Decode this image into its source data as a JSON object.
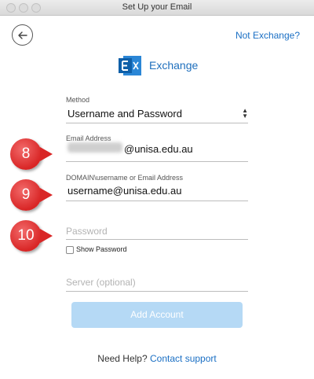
{
  "window": {
    "title": "Set Up your Email"
  },
  "header": {
    "not_exchange_link": "Not Exchange?",
    "brand_name": "Exchange"
  },
  "form": {
    "method": {
      "label": "Method",
      "value": "Username and Password"
    },
    "email": {
      "label": "Email Address",
      "value_visible": "@unisa.edu.au"
    },
    "domain_user": {
      "label": "DOMAIN\\username or Email Address",
      "value": "username@unisa.edu.au"
    },
    "password": {
      "placeholder": "Password"
    },
    "show_password": {
      "label": "Show Password",
      "checked": false
    },
    "server": {
      "placeholder": "Server (optional)"
    },
    "add_account_label": "Add Account"
  },
  "footer": {
    "help_text": "Need Help?",
    "support_link": "Contact support"
  },
  "annotations": {
    "step_8": "8",
    "step_9": "9",
    "step_10": "10"
  },
  "colors": {
    "accent": "#1a6fc4",
    "button_disabled": "#b5d9f5",
    "callout": "#d92626"
  },
  "icons": {
    "back": "back-arrow-icon",
    "brand": "exchange-logo-icon",
    "select": "chevron-updown-icon"
  }
}
